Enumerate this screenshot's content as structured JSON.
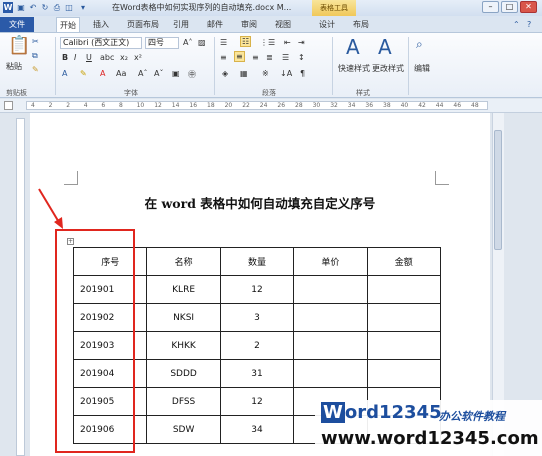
{
  "window": {
    "title": "在Word表格中如何实现序列的自动填充.docx M...",
    "context_tab": "表格工具",
    "minimize_label": "–",
    "maximize_label": "□",
    "close_label": "✕"
  },
  "tabs": [
    {
      "label": "文件"
    },
    {
      "label": "开始"
    },
    {
      "label": "插入"
    },
    {
      "label": "页面布局"
    },
    {
      "label": "引用"
    },
    {
      "label": "邮件"
    },
    {
      "label": "审阅"
    },
    {
      "label": "视图"
    },
    {
      "label": "设计"
    },
    {
      "label": "布局"
    }
  ],
  "ribbon": {
    "paste_label": "粘贴",
    "font_name": "Calibri (西文正文)",
    "font_size": "四号",
    "bold": "B",
    "italic": "I",
    "underline": "U",
    "font_color_label": "A",
    "quick_styles_label": "快速样式",
    "change_styles_label": "更改样式",
    "edit_label": "编辑",
    "groups": {
      "clipboard": "剪贴板",
      "font": "字体",
      "paragraph": "段落",
      "styles": "样式"
    }
  },
  "ruler_ticks": [
    "4",
    "2",
    "2",
    "4",
    "6",
    "8",
    "10",
    "12",
    "14",
    "16",
    "18",
    "20",
    "22",
    "24",
    "26",
    "28",
    "30",
    "32",
    "34",
    "36",
    "38",
    "40",
    "42",
    "44",
    "46",
    "48"
  ],
  "document": {
    "heading": "在 word 表格中如何自动填充自定义序号",
    "table": {
      "headers": [
        "序号",
        "名称",
        "数量",
        "单价",
        "金额"
      ],
      "rows": [
        [
          "201901",
          "KLRE",
          "12",
          "",
          ""
        ],
        [
          "201902",
          "NKSI",
          "3",
          "",
          ""
        ],
        [
          "201903",
          "KHKK",
          "2",
          "",
          ""
        ],
        [
          "201904",
          "SDDD",
          "31",
          "",
          ""
        ],
        [
          "201905",
          "DFSS",
          "12",
          "",
          ""
        ],
        [
          "201906",
          "SDW",
          "34",
          "",
          ""
        ]
      ]
    }
  },
  "watermark": {
    "w": "W",
    "brand": "ord12345",
    "subtitle": "办公软件教程",
    "url": "www.word12345.com"
  },
  "colors": {
    "annotation_red": "#e0261e",
    "file_tab_blue": "#2b5aa8"
  }
}
